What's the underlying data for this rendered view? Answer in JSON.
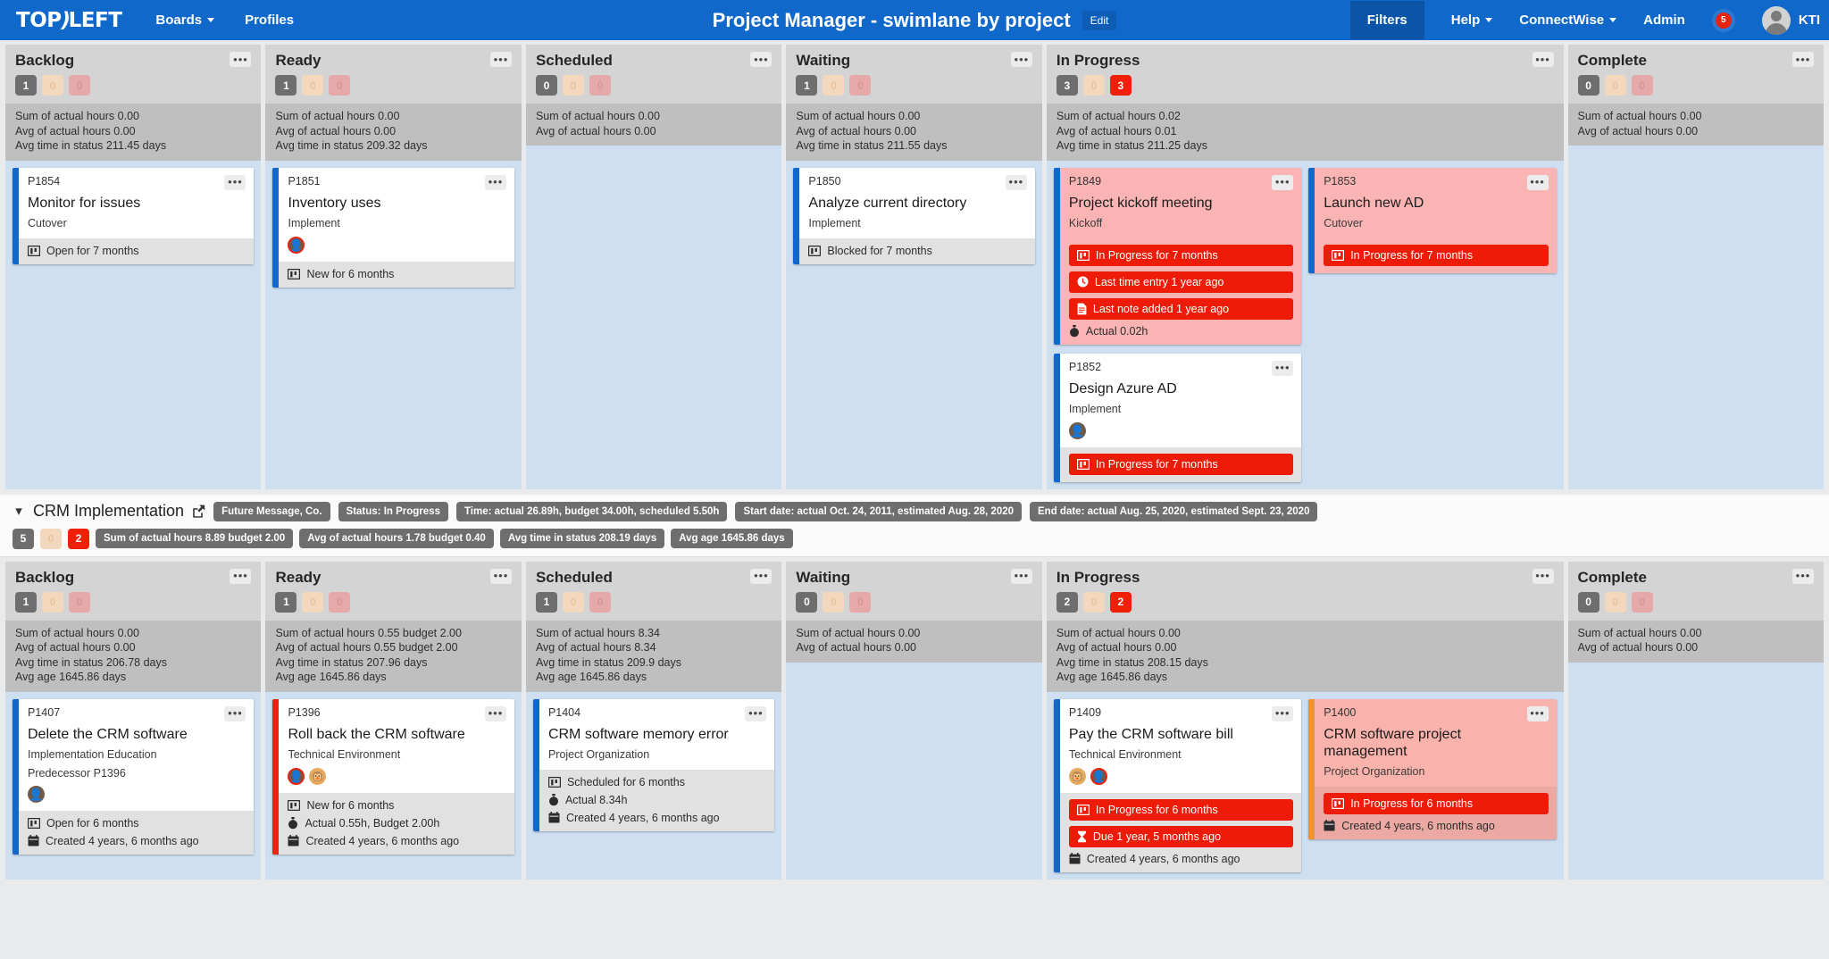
{
  "nav": {
    "logo_top": "TOP",
    "logo_left": "LEFT",
    "links": [
      {
        "label": "Boards",
        "caret": true
      },
      {
        "label": "Profiles",
        "caret": false
      }
    ],
    "board_title": "Project Manager - swimlane by project",
    "edit_label": "Edit",
    "right_links": [
      {
        "label": "Help",
        "caret": true
      },
      {
        "label": "ConnectWise",
        "caret": true
      },
      {
        "label": "Admin",
        "caret": false
      }
    ],
    "filters_label": "Filters",
    "notification_count": "5",
    "user_name": "KTI"
  },
  "swimlanes": [
    {
      "header": null,
      "columns": [
        {
          "title": "Backlog",
          "counts": [
            "1",
            "0",
            "0"
          ],
          "counts_style": [
            "dark",
            "tan",
            "redlight"
          ],
          "stats": [
            "Sum of actual hours 0.00",
            "Avg of actual hours 0.00",
            "Avg time in status 211.45 days"
          ],
          "cards": [
            {
              "id": "P1854",
              "title": "Monitor for issues",
              "sub": "Cutover",
              "stripe": "#1068ca",
              "variant": "white",
              "footer": [
                {
                  "type": "plain",
                  "icon": "kanban-icon",
                  "text": "Open for 7 months"
                }
              ]
            }
          ]
        },
        {
          "title": "Ready",
          "counts": [
            "1",
            "0",
            "0"
          ],
          "counts_style": [
            "dark",
            "tan",
            "redlight"
          ],
          "stats": [
            "Sum of actual hours 0.00",
            "Avg of actual hours 0.00",
            "Avg time in status 209.32 days"
          ],
          "cards": [
            {
              "id": "P1851",
              "title": "Inventory uses",
              "sub": "Implement",
              "stripe": "#1068ca",
              "variant": "white",
              "avatars": [
                {
                  "face": "face1",
                  "ring": true
                }
              ],
              "footer": [
                {
                  "type": "plain",
                  "icon": "kanban-icon",
                  "text": "New for 6 months"
                }
              ]
            }
          ]
        },
        {
          "title": "Scheduled",
          "counts": [
            "0",
            "0",
            "0"
          ],
          "counts_style": [
            "dark",
            "tan",
            "redlight"
          ],
          "stats": [
            "Sum of actual hours 0.00",
            "Avg of actual hours 0.00"
          ],
          "cards": []
        },
        {
          "title": "Waiting",
          "counts": [
            "1",
            "0",
            "0"
          ],
          "counts_style": [
            "dark",
            "tan",
            "redlight"
          ],
          "stats": [
            "Sum of actual hours 0.00",
            "Avg of actual hours 0.00",
            "Avg time in status 211.55 days"
          ],
          "cards": [
            {
              "id": "P1850",
              "title": "Analyze current directory",
              "sub": "Implement",
              "stripe": "#1068ca",
              "variant": "white",
              "footer": [
                {
                  "type": "plain",
                  "icon": "kanban-icon",
                  "text": "Blocked for 7 months"
                }
              ]
            }
          ]
        },
        {
          "title": "In Progress",
          "counts": [
            "3",
            "0",
            "3"
          ],
          "counts_style": [
            "dark",
            "tan",
            "red"
          ],
          "stats": [
            "Sum of actual hours 0.02",
            "Avg of actual hours 0.01",
            "Avg time in status 211.25 days"
          ],
          "wide": true,
          "cards": [
            {
              "id": "P1849",
              "title": "Project kickoff meeting",
              "sub": "Kickoff",
              "stripe": "#1068ca",
              "variant": "pink",
              "footer": [
                {
                  "type": "red",
                  "icon": "kanban-icon",
                  "text": "In Progress for 7 months"
                },
                {
                  "type": "red",
                  "icon": "clock-icon",
                  "text": "Last time entry 1 year ago"
                },
                {
                  "type": "red",
                  "icon": "note-icon",
                  "text": "Last note added 1 year ago"
                },
                {
                  "type": "plain",
                  "icon": "stopwatch-icon",
                  "text": "Actual 0.02h"
                }
              ]
            },
            {
              "id": "P1852",
              "title": "Design Azure AD",
              "sub": "Implement",
              "stripe": "#1068ca",
              "variant": "white",
              "avatars": [
                {
                  "face": "face1",
                  "ring": false
                }
              ],
              "footer": [
                {
                  "type": "red",
                  "icon": "kanban-icon",
                  "text": "In Progress for 7 months"
                }
              ]
            },
            {
              "id": "P1853",
              "title": "Launch new AD",
              "sub": "Cutover",
              "stripe": "#1068ca",
              "variant": "pink",
              "second_col": true,
              "footer": [
                {
                  "type": "red",
                  "icon": "kanban-icon",
                  "text": "In Progress for 7 months"
                }
              ]
            }
          ]
        },
        {
          "title": "Complete",
          "counts": [
            "0",
            "0",
            "0"
          ],
          "counts_style": [
            "dark",
            "tan",
            "redlight"
          ],
          "stats": [
            "Sum of actual hours 0.00",
            "Avg of actual hours 0.00"
          ],
          "cards": []
        }
      ]
    },
    {
      "header": {
        "title": "CRM Implementation",
        "pills": [
          "Future Message, Co.",
          "Status: In Progress",
          "Time: actual 26.89h, budget 34.00h, scheduled 5.50h",
          "Start date: actual Oct. 24, 2011, estimated Aug. 28, 2020",
          "End date: actual Aug. 25, 2020, estimated Sept. 23, 2020"
        ],
        "counts": [
          "5",
          "0",
          "2"
        ],
        "counts_style": [
          "dark",
          "tan",
          "red"
        ],
        "stat_pills": [
          "Sum of actual hours 8.89  budget 2.00",
          "Avg of actual hours 1.78  budget 0.40",
          "Avg time in status 208.19 days",
          "Avg age 1645.86 days"
        ]
      },
      "columns": [
        {
          "title": "Backlog",
          "counts": [
            "1",
            "0",
            "0"
          ],
          "counts_style": [
            "dark",
            "tan",
            "redlight"
          ],
          "stats": [
            "Sum of actual hours 0.00",
            "Avg of actual hours 0.00",
            "Avg time in status 206.78 days",
            "Avg age 1645.86 days"
          ],
          "cards": [
            {
              "id": "P1407",
              "title": "Delete the CRM software",
              "sub": "Implementation Education",
              "predecessor": "Predecessor P1396",
              "stripe": "#1068ca",
              "variant": "white",
              "avatars": [
                {
                  "face": "face1",
                  "ring": false
                }
              ],
              "footer": [
                {
                  "type": "plain",
                  "icon": "kanban-icon",
                  "text": "Open for 6 months"
                },
                {
                  "type": "plain",
                  "icon": "calendar-icon",
                  "text": "Created 4 years, 6 months ago"
                }
              ]
            }
          ]
        },
        {
          "title": "Ready",
          "counts": [
            "1",
            "0",
            "0"
          ],
          "counts_style": [
            "dark",
            "tan",
            "redlight"
          ],
          "stats": [
            "Sum of actual hours 0.55  budget 2.00",
            "Avg of actual hours 0.55  budget 2.00",
            "Avg time in status 207.96 days",
            "Avg age 1645.86 days"
          ],
          "cards": [
            {
              "id": "P1396",
              "title": "Roll back the CRM software",
              "sub": "Technical Environment",
              "stripe": "#e8230f",
              "variant": "white",
              "avatars": [
                {
                  "face": "face1",
                  "ring": true
                },
                {
                  "face": "face2",
                  "ring": false
                }
              ],
              "footer": [
                {
                  "type": "plain",
                  "icon": "kanban-icon",
                  "text": "New for 6 months"
                },
                {
                  "type": "plain",
                  "icon": "stopwatch-icon",
                  "text": "Actual 0.55h, Budget 2.00h"
                },
                {
                  "type": "plain",
                  "icon": "calendar-icon",
                  "text": "Created 4 years, 6 months ago"
                }
              ]
            }
          ]
        },
        {
          "title": "Scheduled",
          "counts": [
            "1",
            "0",
            "0"
          ],
          "counts_style": [
            "dark",
            "tan",
            "redlight"
          ],
          "stats": [
            "Sum of actual hours 8.34",
            "Avg of actual hours 8.34",
            "Avg time in status 209.9 days",
            "Avg age 1645.86 days"
          ],
          "cards": [
            {
              "id": "P1404",
              "title": "CRM software memory error",
              "sub": "Project Organization",
              "stripe": "#1068ca",
              "variant": "white",
              "footer": [
                {
                  "type": "plain",
                  "icon": "kanban-icon",
                  "text": "Scheduled for 6 months"
                },
                {
                  "type": "plain",
                  "icon": "stopwatch-icon",
                  "text": "Actual 8.34h"
                },
                {
                  "type": "plain",
                  "icon": "calendar-icon",
                  "text": "Created 4 years, 6 months ago"
                }
              ]
            }
          ]
        },
        {
          "title": "Waiting",
          "counts": [
            "0",
            "0",
            "0"
          ],
          "counts_style": [
            "dark",
            "tan",
            "redlight"
          ],
          "stats": [
            "Sum of actual hours 0.00",
            "Avg of actual hours 0.00"
          ],
          "cards": []
        },
        {
          "title": "In Progress",
          "counts": [
            "2",
            "0",
            "2"
          ],
          "counts_style": [
            "dark",
            "tan",
            "red"
          ],
          "stats": [
            "Sum of actual hours 0.00",
            "Avg of actual hours 0.00",
            "Avg time in status 208.15 days",
            "Avg age 1645.86 days"
          ],
          "wide": true,
          "cards": [
            {
              "id": "P1409",
              "title": "Pay the CRM software bill",
              "sub": "Technical Environment",
              "stripe": "#1068ca",
              "variant": "white",
              "avatars": [
                {
                  "face": "face2",
                  "ring": false
                },
                {
                  "face": "face1",
                  "ring": true
                }
              ],
              "footer": [
                {
                  "type": "red",
                  "icon": "kanban-icon",
                  "text": "In Progress for 6 months"
                },
                {
                  "type": "red",
                  "icon": "hourglass-icon",
                  "text": "Due 1 year, 5 months ago"
                },
                {
                  "type": "plain",
                  "icon": "calendar-icon",
                  "text": "Created 4 years, 6 months ago"
                }
              ]
            },
            {
              "id": "P1400",
              "title": "CRM software project management",
              "sub": "Project Organization",
              "stripe": "#f0922e",
              "variant": "pink-orange",
              "second_col": true,
              "footer": [
                {
                  "type": "red",
                  "icon": "kanban-icon",
                  "text": "In Progress for 6 months"
                },
                {
                  "type": "plain",
                  "icon": "calendar-icon",
                  "text": "Created 4 years, 6 months ago"
                }
              ]
            }
          ]
        },
        {
          "title": "Complete",
          "counts": [
            "0",
            "0",
            "0"
          ],
          "counts_style": [
            "dark",
            "tan",
            "redlight"
          ],
          "stats": [
            "Sum of actual hours 0.00",
            "Avg of actual hours 0.00"
          ],
          "cards": []
        }
      ]
    }
  ],
  "colors": {
    "brand_blue": "#1068ca",
    "alert_red": "#ee1b09",
    "card_blue_stripe": "#1068ca",
    "card_red_stripe": "#e8230f",
    "card_orange_stripe": "#f0922e",
    "column_bg": "#cddff1"
  }
}
